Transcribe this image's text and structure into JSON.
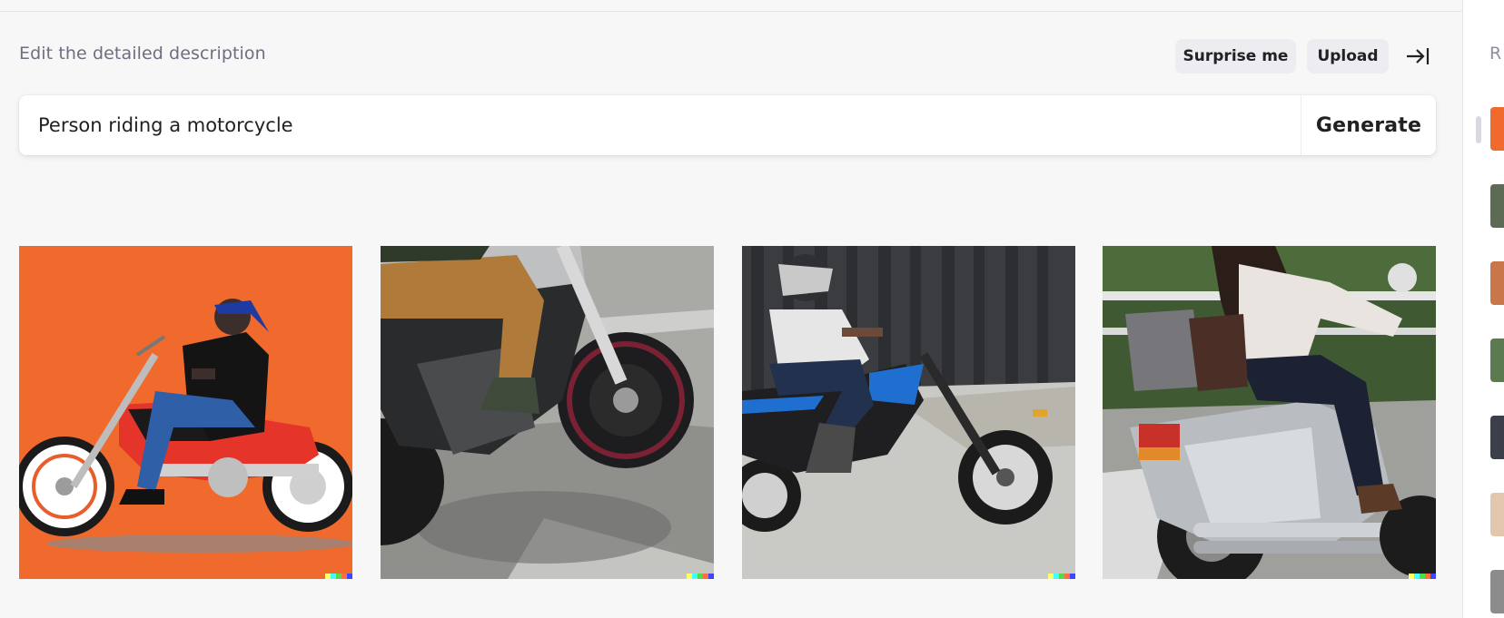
{
  "header": {
    "section_label": "Edit the detailed description",
    "surprise_label": "Surprise me",
    "upload_label": "Upload",
    "collapse_icon": "arrow-right-to-bar-icon"
  },
  "prompt": {
    "value": "Person riding a motorcycle",
    "generate_label": "Generate"
  },
  "results": [
    {
      "name": "result-image-1",
      "description_icon": "illustration-orange-motorcycle"
    },
    {
      "name": "result-image-2",
      "description_icon": "photo-motorcycle-closeup"
    },
    {
      "name": "result-image-3",
      "description_icon": "photo-blue-motorcycle"
    },
    {
      "name": "result-image-4",
      "description_icon": "photo-woman-silver-motorcycle"
    }
  ],
  "signature_colors": [
    "#ffff66",
    "#42ffff",
    "#51da4c",
    "#ff6e3c",
    "#3c46ff"
  ],
  "history_panel": {
    "title": "R",
    "thumb_colors": [
      "#f06a2e",
      "#5d6b55",
      "#c9764a",
      "#5b7a4f",
      "#3a3f4a",
      "#e2c6ad",
      "#8c8c8c"
    ]
  }
}
